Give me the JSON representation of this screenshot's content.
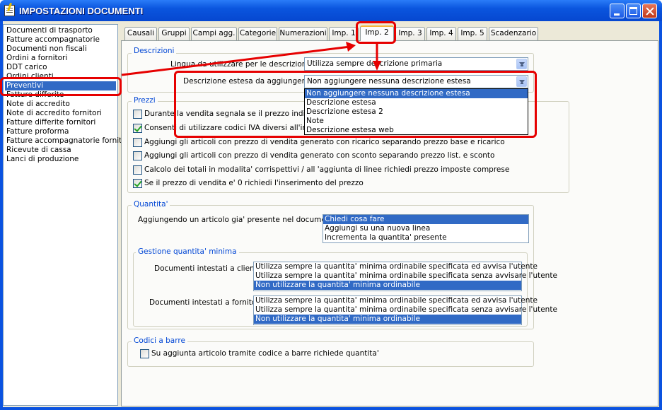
{
  "window": {
    "title": "IMPOSTAZIONI DOCUMENTI"
  },
  "sidebar": {
    "items": [
      "Documenti di trasporto",
      "Fatture accompagnatorie",
      "Documenti non fiscali",
      "Ordini a fornitori",
      "DDT carico",
      "Ordini clienti",
      "Preventivi",
      "Fatture differite",
      "Note di accredito",
      "Note di accredito fornitori",
      "Fatture differite fornitori",
      "Fatture proforma",
      "Fatture accompagnatorie fornitori",
      "Ricevute di cassa",
      "Lanci di produzione"
    ],
    "selected": "Preventivi"
  },
  "tabs": [
    "Causali",
    "Gruppi",
    "Campi agg.",
    "Categorie",
    "Numerazioni",
    "Imp. 1",
    "Imp. 2",
    "Imp. 3",
    "Imp. 4",
    "Imp. 5",
    "Scadenzario"
  ],
  "active_tab": "Imp. 2",
  "descrizioni": {
    "label": "Descrizioni",
    "lingua_label": "Lingua da utilizzare per le descrizioni :",
    "lingua_value": "Utilizza sempre descrizione primaria",
    "estesa_label": "Descrizione estesa da aggiungere :",
    "estesa_value": "Non aggiungere nessuna descrizione estesa",
    "estesa_options": [
      "Non aggiungere nessuna descrizione estesa",
      "Descrizione estesa",
      "Descrizione estesa 2",
      "Note",
      "Descrizione estesa web"
    ]
  },
  "prezzi": {
    "label": "Prezzi",
    "checks": [
      {
        "label": "Durante la vendita segnala se il prezzo indicato",
        "checked": false
      },
      {
        "label": "Consenti di utilizzare codici IVA diversi all'interno",
        "checked": true
      },
      {
        "label": "Aggiungi gli articoli con prezzo di vendita generato con ricarico separando prezzo base e ricarico",
        "checked": false
      },
      {
        "label": "Aggiungi gli articoli con prezzo di vendita generato con sconto separando prezzo list. e sconto",
        "checked": false
      },
      {
        "label": "Calcolo dei totali in modalita' corrispettivi / all 'aggiunta di linee richiedi prezzo imposte comprese",
        "checked": false
      },
      {
        "label": "Se il prezzo di vendita e' 0 richiedi l'inserimento del prezzo",
        "checked": true
      }
    ]
  },
  "quantita": {
    "label": "Quantita'",
    "aggiungendo_label": "Aggiungendo un articolo gia' presente nel documento :",
    "aggiungendo_options": [
      "Chiedi cosa fare",
      "Aggiungi su una nuova linea",
      "Incrementa la quantita' presente"
    ],
    "minima": {
      "label": "Gestione quantita' minima",
      "clienti_label": "Documenti intestati a clienti :",
      "fornitori_label": "Documenti intestati a fornitori :",
      "options": [
        "Utilizza sempre la quantita' minima ordinabile specificata ed avvisa l'utente",
        "Utilizza sempre la quantita' minima ordinabile specificata senza avvisare l'utente",
        "Non utilizzare la quantita' minima ordinabile"
      ]
    }
  },
  "codici": {
    "label": "Codici a barre",
    "check_label": "Su aggiunta articolo tramite codice a barre richiede quantita'",
    "checked": false
  },
  "colors": {
    "highlight": "#e60000",
    "selection": "#316ac5",
    "titlebar": "#0a55de"
  }
}
